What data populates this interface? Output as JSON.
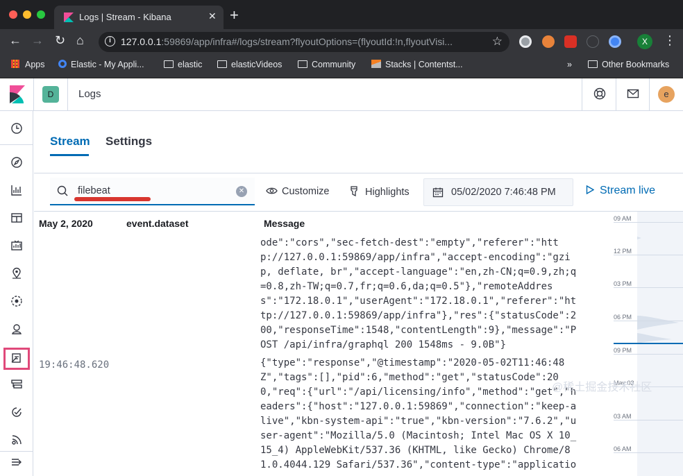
{
  "browser": {
    "tab_title": "Logs | Stream - Kibana",
    "url_host": "127.0.0.1",
    "url_rest": ":59869/app/infra#/logs/stream?flyoutOptions=(flyoutId:!n,flyoutVisi...",
    "bookmarks": [
      "Apps",
      "Elastic - My Appli...",
      "elastic",
      "elasticVideos",
      "Community",
      "Stacks | Contentst...",
      "Other Bookmarks"
    ],
    "more_bookmarks": "»",
    "profile_initial": "X"
  },
  "header": {
    "space_initial": "D",
    "app_title": "Logs",
    "user_initial": "e"
  },
  "tabs": [
    {
      "label": "Stream",
      "active": true
    },
    {
      "label": "Settings",
      "active": false
    }
  ],
  "controls": {
    "search_value": "filebeat",
    "customize_label": "Customize",
    "highlights_label": "Highlights",
    "date_value": "05/02/2020 7:46:48 PM",
    "stream_live_label": "Stream live"
  },
  "table": {
    "col_date": "May 2, 2020",
    "col_dataset": "event.dataset",
    "col_message": "Message",
    "timestamp": "19:46:48.620",
    "message_lines": [
      "ode\":\"cors\",\"sec-fetch-dest\":\"empty\",\"referer\":\"htt",
      "p://127.0.0.1:59869/app/infra\",\"accept-encoding\":\"gzi",
      "p, deflate, br\",\"accept-language\":\"en,zh-CN;q=0.9,zh;q",
      "=0.8,zh-TW;q=0.7,fr;q=0.6,da;q=0.5\"},\"remoteAddres",
      "s\":\"172.18.0.1\",\"userAgent\":\"172.18.0.1\",\"referer\":\"ht",
      "tp://127.0.0.1:59869/app/infra\"},\"res\":{\"statusCode\":2",
      "00,\"responseTime\":1548,\"contentLength\":9},\"message\":\"P",
      "OST /api/infra/graphql 200 1548ms - 9.0B\"}",
      "{\"type\":\"response\",\"@timestamp\":\"2020-05-02T11:46:48",
      "Z\",\"tags\":[],\"pid\":6,\"method\":\"get\",\"statusCode\":20",
      "0,\"req\":{\"url\":\"/api/licensing/info\",\"method\":\"get\",\"h",
      "eaders\":{\"host\":\"127.0.0.1:59869\",\"connection\":\"keep-a",
      "live\",\"kbn-system-api\":\"true\",\"kbn-version\":\"7.6.2\",\"u",
      "ser-agent\":\"Mozilla/5.0 (Macintosh; Intel Mac OS X 10_",
      "15_4) AppleWebKit/537.36 (KHTML, like Gecko) Chrome/8",
      "1.0.4044.129 Safari/537.36\",\"content-type\":\"applicatio"
    ]
  },
  "minimap": {
    "ticks": [
      "09 AM",
      "12 PM",
      "03 PM",
      "06 PM",
      "09 PM",
      "May 03",
      "03 AM",
      "06 AM"
    ]
  },
  "watermark": "@稀土掘金技术社区",
  "colors": {
    "accent": "#006bb4",
    "space_badge": "#54b399",
    "avatar": "#e7a35f",
    "annotation_red": "#d8362f",
    "annotation_pink": "#e0497a"
  }
}
